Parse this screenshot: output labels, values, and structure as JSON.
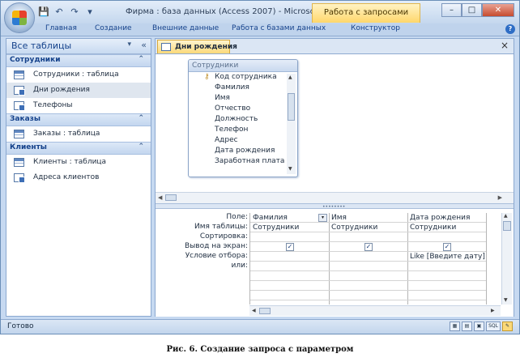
{
  "window": {
    "title": "Фирма : база данных (Access 2007) - Microsoft Acce...",
    "context_tab": "Работа с запросами",
    "minimize_glyph": "–",
    "maximize_glyph": "□",
    "close_glyph": "✕"
  },
  "quick_access": {
    "save_icon": "💾",
    "undo_icon": "↶",
    "redo_icon": "↷",
    "customize_icon": "▾"
  },
  "ribbon": {
    "tabs": [
      "Главная",
      "Создание",
      "Внешние данные",
      "Работа с базами данных",
      "Конструктор"
    ],
    "help_glyph": "?"
  },
  "nav": {
    "title": "Все таблицы",
    "dropdown_glyph": "▾",
    "collapse_glyph": "«",
    "groups": [
      {
        "label": "Сотрудники",
        "chevron": "⌃",
        "items": [
          {
            "label": "Сотрудники : таблица",
            "type": "table"
          },
          {
            "label": "Дни рождения",
            "type": "query",
            "selected": true
          },
          {
            "label": "Телефоны",
            "type": "query"
          }
        ]
      },
      {
        "label": "Заказы",
        "chevron": "⌃",
        "items": [
          {
            "label": "Заказы : таблица",
            "type": "table"
          }
        ]
      },
      {
        "label": "Клиенты",
        "chevron": "⌃",
        "items": [
          {
            "label": "Клиенты : таблица",
            "type": "table"
          },
          {
            "label": "Адреса клиентов",
            "type": "query"
          }
        ]
      }
    ]
  },
  "document": {
    "tab_label": "Дни рождения",
    "close_glyph": "×",
    "field_list": {
      "title": "Сотрудники",
      "key_icon": "key-icon",
      "fields": [
        "Код сотрудника",
        "Фамилия",
        "Имя",
        "Отчество",
        "Должность",
        "Телефон",
        "Адрес",
        "Дата рождения",
        "Заработная плата"
      ]
    },
    "splitter_grip": "••••••••",
    "grid": {
      "row_labels": [
        "Поле:",
        "Имя таблицы:",
        "Сортировка:",
        "Вывод на экран:",
        "Условие отбора:",
        "или:"
      ],
      "columns": [
        {
          "field": "Фамилия",
          "table": "Сотрудники",
          "sort": "",
          "show": true,
          "criteria": "",
          "has_dropdown": true
        },
        {
          "field": "Имя",
          "table": "Сотрудники",
          "sort": "",
          "show": true,
          "criteria": ""
        },
        {
          "field": "Дата рождения",
          "table": "Сотрудники",
          "sort": "",
          "show": true,
          "criteria": "Like [Введите дату]"
        }
      ],
      "check_glyph": "✓",
      "dropdown_glyph": "▾"
    }
  },
  "status": {
    "text": "Готово",
    "views": [
      "▦",
      "▤",
      "▣",
      "SQL",
      "✎"
    ]
  },
  "caption": "Рис. 6. Создание запроса с параметром"
}
